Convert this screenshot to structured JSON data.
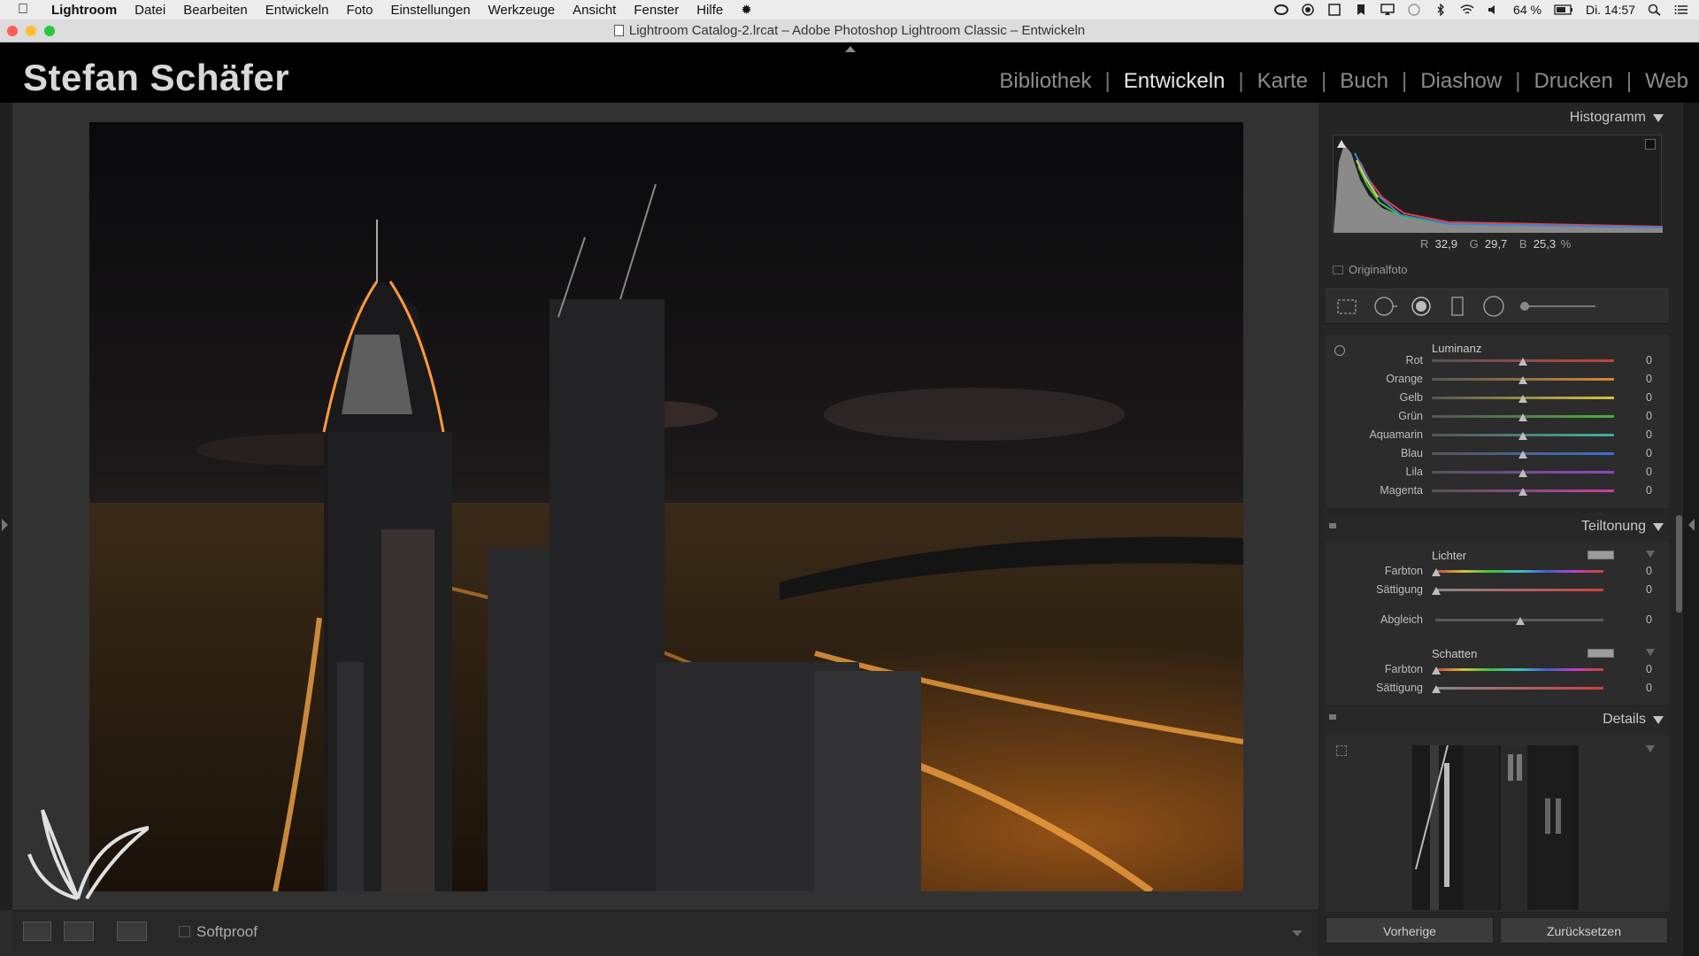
{
  "menubar": {
    "items": [
      "Lightroom",
      "Datei",
      "Bearbeiten",
      "Entwickeln",
      "Foto",
      "Einstellungen",
      "Werkzeuge",
      "Ansicht",
      "Fenster",
      "Hilfe"
    ],
    "battery": "64 %",
    "clock": "Di. 14:57"
  },
  "window": {
    "title": "Lightroom Catalog-2.lrcat – Adobe Photoshop Lightroom Classic – Entwickeln"
  },
  "identity": {
    "name": "Stefan Schäfer"
  },
  "modules": [
    {
      "label": "Bibliothek",
      "active": false
    },
    {
      "label": "Entwickeln",
      "active": true
    },
    {
      "label": "Karte",
      "active": false
    },
    {
      "label": "Buch",
      "active": false
    },
    {
      "label": "Diashow",
      "active": false
    },
    {
      "label": "Drucken",
      "active": false
    },
    {
      "label": "Web",
      "active": false
    }
  ],
  "toolbar": {
    "softproof_label": "Softproof"
  },
  "histogram": {
    "title": "Histogramm",
    "r_label": "R",
    "r_value": "32,9",
    "g_label": "G",
    "g_value": "29,7",
    "b_label": "B",
    "b_value": "25,3",
    "unit": "%",
    "original_label": "Originalfoto"
  },
  "luminance": {
    "title": "Luminanz",
    "sliders": [
      {
        "label": "Rot",
        "value": "0",
        "color": "#c84040"
      },
      {
        "label": "Orange",
        "value": "0",
        "color": "#d48a30"
      },
      {
        "label": "Gelb",
        "value": "0",
        "color": "#d6c63a"
      },
      {
        "label": "Grün",
        "value": "0",
        "color": "#4fae3e"
      },
      {
        "label": "Aquamarin",
        "value": "0",
        "color": "#3fb0a4"
      },
      {
        "label": "Blau",
        "value": "0",
        "color": "#3e6fd0"
      },
      {
        "label": "Lila",
        "value": "0",
        "color": "#8a48c8"
      },
      {
        "label": "Magenta",
        "value": "0",
        "color": "#c63ea8"
      }
    ]
  },
  "split_toning": {
    "title": "Teiltonung",
    "highlights_title": "Lichter",
    "highlights": [
      {
        "label": "Farbton",
        "value": "0"
      },
      {
        "label": "Sättigung",
        "value": "0"
      }
    ],
    "balance": {
      "label": "Abgleich",
      "value": "0"
    },
    "shadows_title": "Schatten",
    "shadows": [
      {
        "label": "Farbton",
        "value": "0"
      },
      {
        "label": "Sättigung",
        "value": "0"
      }
    ]
  },
  "details": {
    "title": "Details"
  },
  "bottom": {
    "previous": "Vorherige",
    "reset": "Zurücksetzen"
  }
}
